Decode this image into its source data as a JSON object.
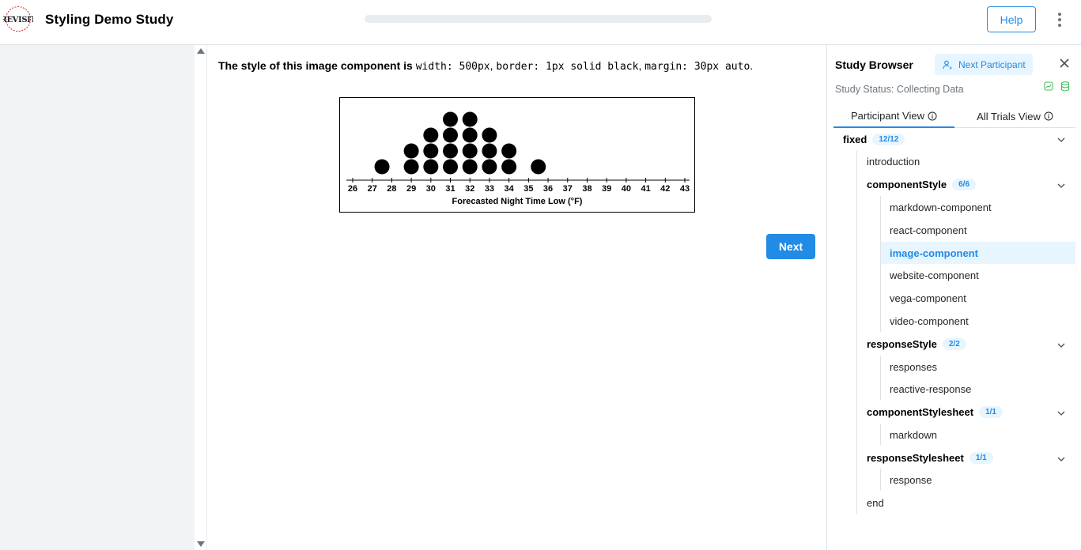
{
  "header": {
    "app_title": "Styling Demo Study",
    "logo_text": "REVISIT",
    "progress_percent": 0,
    "help_label": "Help",
    "menu_icon": "kebab-menu-icon"
  },
  "main": {
    "instruction_bold": "The style of this image component is",
    "code_width": "width: 500px",
    "code_border": "border: 1px solid black",
    "code_margin": "margin: 30px auto",
    "sep1": ",",
    "sep2": ",",
    "end_period": ".",
    "next_label": "Next",
    "chart_data": {
      "type": "scatter",
      "xlabel": "Forecasted Night Time Low (°F)",
      "ylabel": "",
      "title": "",
      "x_ticks": [
        26,
        27,
        28,
        29,
        30,
        31,
        32,
        33,
        34,
        35,
        36,
        37,
        38,
        39,
        40,
        41,
        42,
        43
      ],
      "xlim": [
        26,
        43
      ],
      "dot_counts": {
        "27.5": 1,
        "29": 2,
        "30": 3,
        "31": 4,
        "32": 4,
        "33": 3,
        "34": 2,
        "35.5": 1
      },
      "grid": false
    }
  },
  "browser": {
    "title": "Study Browser",
    "next_participant_label": "Next Participant",
    "study_status": "Study Status: Collecting Data",
    "tabs": [
      {
        "label": "Participant View",
        "active": true
      },
      {
        "label": "All Trials View",
        "active": false
      }
    ],
    "tree": {
      "root": {
        "label": "fixed",
        "badge": "12/12"
      },
      "introduction": "introduction",
      "groups": [
        {
          "label": "componentStyle",
          "badge": "6/6",
          "items": [
            "markdown-component",
            "react-component",
            "image-component",
            "website-component",
            "vega-component",
            "video-component"
          ]
        },
        {
          "label": "responseStyle",
          "badge": "2/2",
          "items": [
            "responses",
            "reactive-response"
          ]
        },
        {
          "label": "componentStylesheet",
          "badge": "1/1",
          "items": [
            "markdown"
          ]
        },
        {
          "label": "responseStylesheet",
          "badge": "1/1",
          "items": [
            "response"
          ]
        }
      ],
      "end": "end",
      "selected": "image-component"
    }
  },
  "colors": {
    "accent": "#228be6",
    "accent_light": "#e7f5ff",
    "sidebar_bg": "#f1f3f5",
    "status_green": "#40c057"
  }
}
